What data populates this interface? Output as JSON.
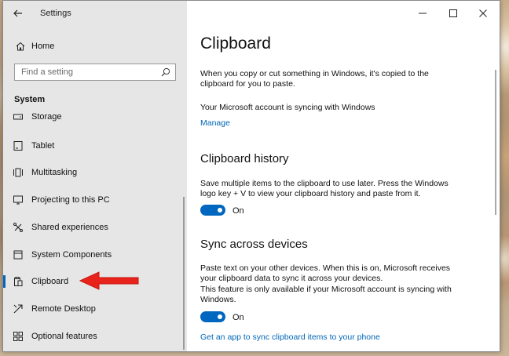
{
  "window": {
    "title": "Settings"
  },
  "sidebar": {
    "home_label": "Home",
    "search_placeholder": "Find a setting",
    "section_label": "System",
    "items": [
      {
        "label": "Storage",
        "icon": "storage-icon"
      },
      {
        "label": "Tablet",
        "icon": "tablet-icon"
      },
      {
        "label": "Multitasking",
        "icon": "multitasking-icon"
      },
      {
        "label": "Projecting to this PC",
        "icon": "projecting-icon"
      },
      {
        "label": "Shared experiences",
        "icon": "shared-experiences-icon"
      },
      {
        "label": "System Components",
        "icon": "system-components-icon"
      },
      {
        "label": "Clipboard",
        "icon": "clipboard-icon",
        "selected": true
      },
      {
        "label": "Remote Desktop",
        "icon": "remote-desktop-icon"
      },
      {
        "label": "Optional features",
        "icon": "optional-features-icon"
      }
    ]
  },
  "main": {
    "title": "Clipboard",
    "intro_line1": "When you copy or cut something in Windows, it's copied to the",
    "intro_line2": "clipboard for you to paste.",
    "sync_status": "Your Microsoft account is syncing with Windows",
    "manage_link": "Manage",
    "history": {
      "heading": "Clipboard history",
      "desc_line1": "Save multiple items to the clipboard to use later. Press the Windows",
      "desc_line2": "logo key + V to view your clipboard history and paste from it.",
      "toggle_label": "On"
    },
    "sync": {
      "heading": "Sync across devices",
      "desc_line1": "Paste text on your other devices. When this is on, Microsoft receives",
      "desc_line2": "your clipboard data to sync it across your devices.",
      "desc_line3": "This feature is only available if your Microsoft account is syncing with",
      "desc_line4": "Windows.",
      "toggle_label": "On",
      "app_link": "Get an app to sync clipboard items to your phone"
    }
  },
  "colors": {
    "accent": "#0067c0",
    "link": "#0067b8",
    "sidebar_bg": "#e6e6e6",
    "arrow": "#e8231c"
  }
}
